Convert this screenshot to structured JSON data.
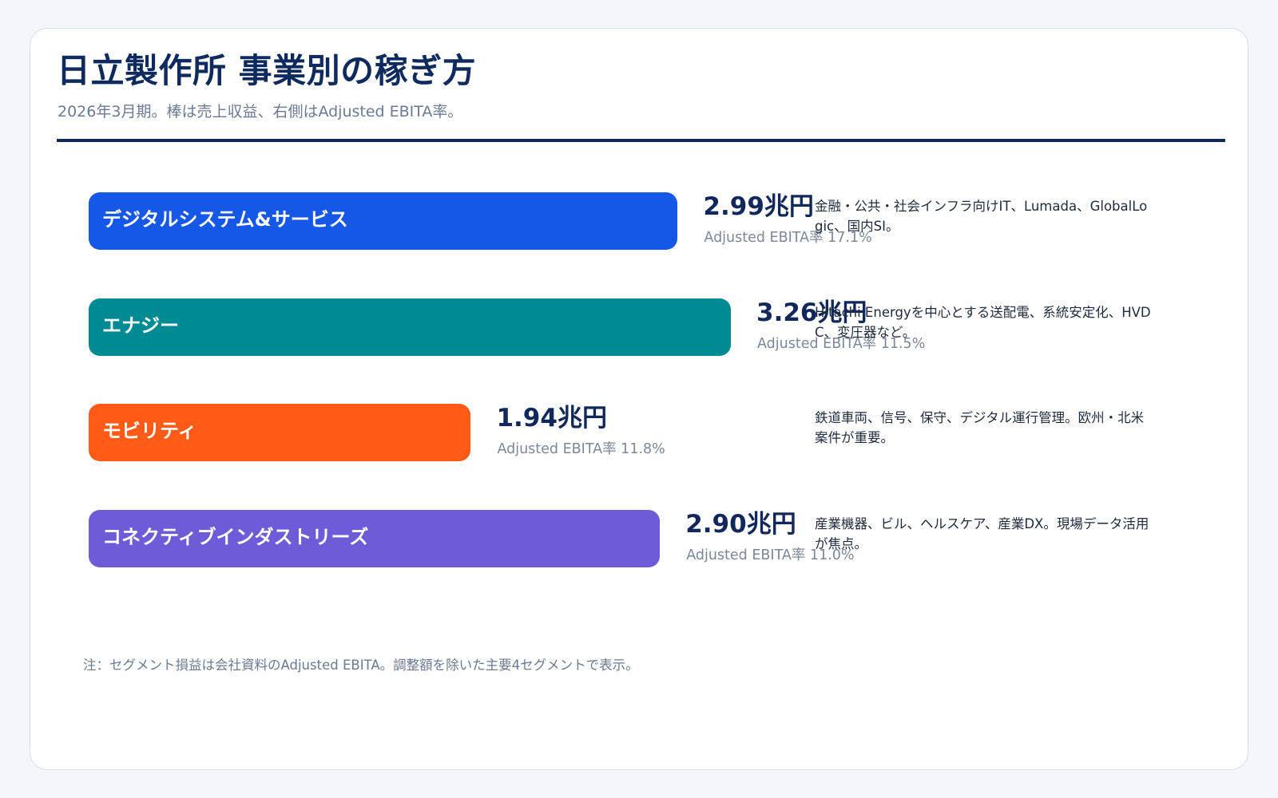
{
  "header": {
    "title": "日立製作所 事業別の稼ぎ方",
    "subtitle": "2026年3月期。棒は売上収益、右側はAdjusted EBITA率。"
  },
  "note": "注：セグメント損益は会社資料のAdjusted EBITA。調整額を除いた主要4セグメントで表示。",
  "chart_data": {
    "type": "bar",
    "orientation": "horizontal",
    "title": "日立製作所 事業別の稼ぎ方",
    "subtitle": "2026年3月期。棒は売上収益、右側はAdjusted EBITA率。",
    "value_unit": "兆円",
    "categories": [
      "デジタルシステム&サービス",
      "エナジー",
      "モビリティ",
      "コネクティブインダストリーズ"
    ],
    "values": [
      2.99,
      3.26,
      1.94,
      2.9
    ],
    "value_labels": [
      "2.99兆円",
      "3.26兆円",
      "1.94兆円",
      "2.90兆円"
    ],
    "margin_labels": [
      "Adjusted EBITA率 17.1%",
      "Adjusted EBITA率 11.5%",
      "Adjusted EBITA率 11.8%",
      "Adjusted EBITA率 11.0%"
    ],
    "margins_pct": [
      17.1,
      11.5,
      11.8,
      11.0
    ],
    "descriptions": [
      "金融・公共・社会インフラ向けIT、Lumada、GlobalLogic、国内SI。",
      "Hitachi Energyを中心とする送配電、系統安定化、HVDC、変圧器など。",
      "鉄道車両、信号、保守、デジタル運行管理。欧州・北米案件が重要。",
      "産業機器、ビル、ヘルスケア、産業DX。現場データ活用が焦点。"
    ],
    "colors": [
      "#1557e6",
      "#008b94",
      "#ff5a16",
      "#6e5bd8"
    ],
    "xlim": [
      0,
      3.26
    ]
  }
}
